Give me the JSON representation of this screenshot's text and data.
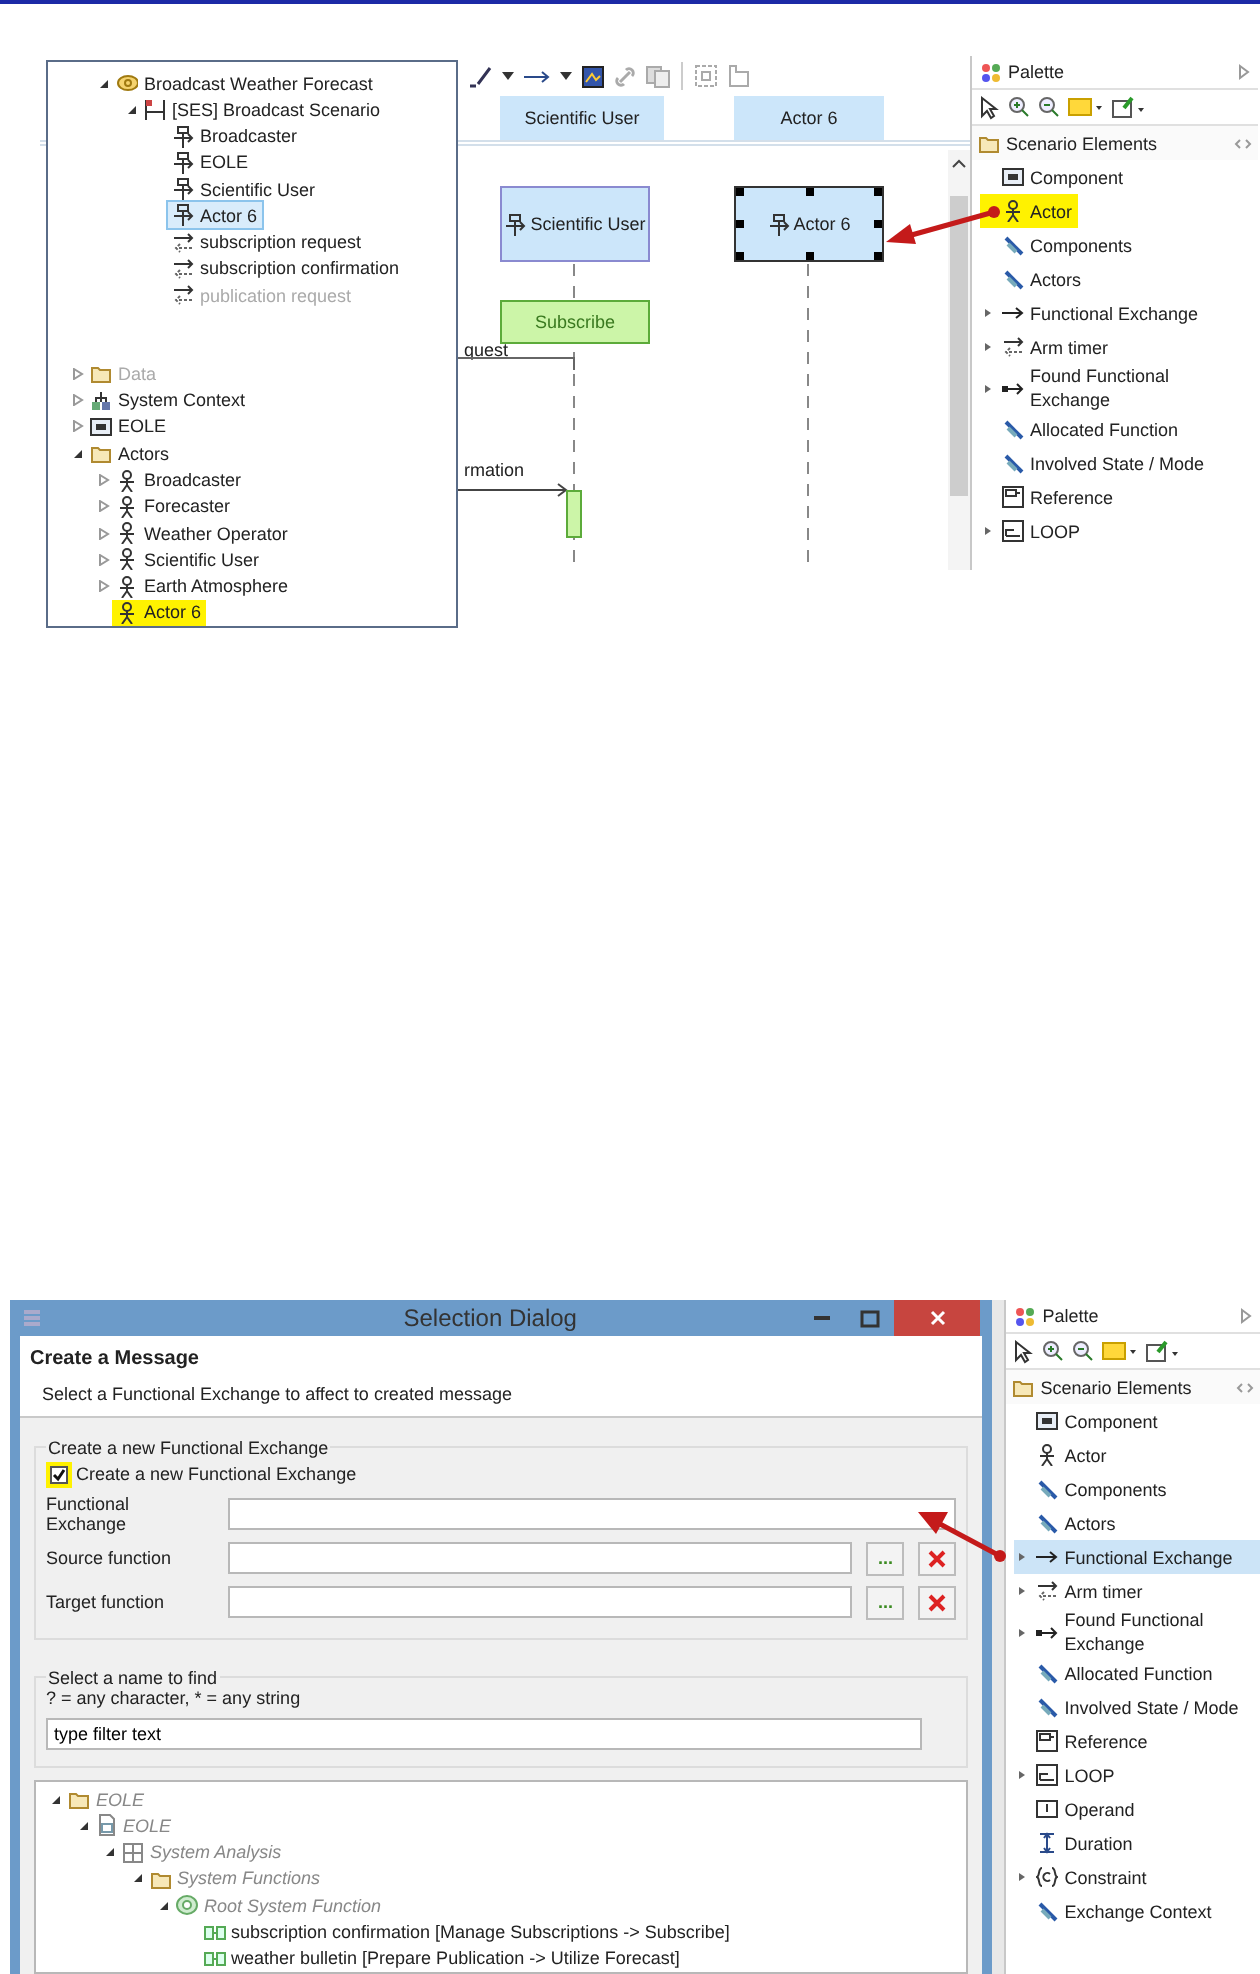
{
  "editor": {
    "lifeline_headers": [
      "Scientific User",
      "Actor 6"
    ],
    "lifelines": [
      {
        "label": "Scientific User",
        "selected": false
      },
      {
        "label": "Actor 6",
        "selected": true
      }
    ],
    "execution": "Subscribe",
    "messages": [
      "quest",
      "rmation"
    ]
  },
  "model_tree": {
    "upper": [
      {
        "label": "Broadcast Weather Forecast",
        "kind": "capability",
        "expanded": true,
        "selected": false,
        "highlighted": false,
        "faded": false,
        "children": [
          {
            "label": "[SES] Broadcast Scenario",
            "kind": "scenario",
            "expanded": true,
            "selected": false,
            "highlighted": false,
            "faded": false,
            "children": [
              {
                "label": "Broadcaster",
                "kind": "lifeline",
                "selected": false,
                "highlighted": false,
                "faded": false
              },
              {
                "label": "EOLE",
                "kind": "lifeline",
                "selected": false,
                "highlighted": false,
                "faded": false
              },
              {
                "label": "Scientific User",
                "kind": "lifeline",
                "selected": false,
                "highlighted": false,
                "faded": false
              },
              {
                "label": "Actor 6",
                "kind": "lifeline",
                "selected": true,
                "highlighted": false,
                "faded": false
              },
              {
                "label": "subscription request",
                "kind": "exchange",
                "selected": false,
                "highlighted": false,
                "faded": false
              },
              {
                "label": "subscription confirmation",
                "kind": "exchange",
                "selected": false,
                "highlighted": false,
                "faded": false
              },
              {
                "label": "publication request",
                "kind": "exchange",
                "selected": false,
                "highlighted": false,
                "faded": true
              }
            ]
          }
        ]
      }
    ],
    "lower": [
      {
        "label": "Data",
        "kind": "folder",
        "expanded": false,
        "selected": false,
        "highlighted": false,
        "faded": true
      },
      {
        "label": "System Context",
        "kind": "context",
        "expanded": false,
        "selected": false,
        "highlighted": false,
        "faded": false
      },
      {
        "label": "EOLE",
        "kind": "component",
        "expanded": false,
        "selected": false,
        "highlighted": false,
        "faded": false
      },
      {
        "label": "Actors",
        "kind": "folder",
        "expanded": true,
        "selected": false,
        "highlighted": false,
        "faded": false,
        "children": [
          {
            "label": "Broadcaster",
            "kind": "actor",
            "expanded": false,
            "selected": false,
            "highlighted": false,
            "faded": false
          },
          {
            "label": "Forecaster",
            "kind": "actor",
            "expanded": false,
            "selected": false,
            "highlighted": false,
            "faded": false
          },
          {
            "label": "Weather Operator",
            "kind": "actor",
            "expanded": false,
            "selected": false,
            "highlighted": false,
            "faded": false
          },
          {
            "label": "Scientific User",
            "kind": "actor",
            "expanded": false,
            "selected": false,
            "highlighted": false,
            "faded": false
          },
          {
            "label": "Earth Atmosphere",
            "kind": "actor",
            "expanded": false,
            "selected": false,
            "highlighted": false,
            "faded": false
          },
          {
            "label": "Actor 6",
            "kind": "actor",
            "selected": false,
            "highlighted": true,
            "faded": false
          }
        ]
      }
    ]
  },
  "palette_top": {
    "title": "Palette",
    "drawer": "Scenario Elements",
    "items": [
      {
        "label": "Component",
        "kind": "component",
        "selected": false,
        "highlighted": false
      },
      {
        "label": "Actor",
        "kind": "actor",
        "selected": false,
        "highlighted": true
      },
      {
        "label": "Components",
        "kind": "filter",
        "selected": false,
        "highlighted": false
      },
      {
        "label": "Actors",
        "kind": "filter",
        "selected": false,
        "highlighted": false
      },
      {
        "label": "Functional Exchange",
        "kind": "arrow",
        "expanded": false,
        "selected": false,
        "highlighted": false
      },
      {
        "label": "Arm timer",
        "kind": "exchange",
        "expanded": false,
        "selected": false,
        "highlighted": false
      },
      {
        "label": "Found Functional Exchange",
        "kind": "found",
        "expanded": false,
        "selected": false,
        "highlighted": false
      },
      {
        "label": "Allocated Function",
        "kind": "filter",
        "selected": false,
        "highlighted": false
      },
      {
        "label": "Involved State / Mode",
        "kind": "filter",
        "selected": false,
        "highlighted": false
      },
      {
        "label": "Reference",
        "kind": "reference",
        "selected": false,
        "highlighted": false
      },
      {
        "label": "LOOP",
        "kind": "loop",
        "expanded": false,
        "selected": false,
        "highlighted": false
      }
    ]
  },
  "dialog": {
    "title": "Selection Dialog",
    "heading": "Create a Message",
    "description": "Select a Functional Exchange to affect to created message",
    "exchange_group": {
      "legend": "Create a new Functional Exchange",
      "checkbox": {
        "label": "Create a new Functional Exchange",
        "checked": true,
        "highlighted": true
      },
      "fields": [
        {
          "label": "Functional Exchange",
          "kind": "plain"
        },
        {
          "label": "Source function",
          "kind": "browse",
          "browse_label": "..."
        },
        {
          "label": "Target function",
          "kind": "browse",
          "browse_label": "..."
        }
      ]
    },
    "filter_group": {
      "legend": "Select a name to find",
      "hint": "? = any character, * = any string",
      "value": "type filter text"
    },
    "tree": [
      {
        "label": "EOLE",
        "kind": "folder",
        "expanded": true,
        "disabled": true,
        "selected": false,
        "children": [
          {
            "label": "EOLE",
            "kind": "project",
            "expanded": true,
            "disabled": true,
            "selected": false,
            "children": [
              {
                "label": "System Analysis",
                "kind": "grid",
                "expanded": true,
                "disabled": true,
                "selected": false,
                "children": [
                  {
                    "label": "System Functions",
                    "kind": "folder",
                    "expanded": true,
                    "disabled": true,
                    "selected": false,
                    "children": [
                      {
                        "label": "Root System Function",
                        "kind": "function",
                        "expanded": true,
                        "disabled": true,
                        "selected": false,
                        "children": [
                          {
                            "label": "subscription confirmation [Manage Subscriptions -> Subscribe]",
                            "kind": "link",
                            "disabled": false,
                            "selected": false
                          },
                          {
                            "label": "weather bulletin [Prepare Publication -> Utilize Forecast]",
                            "kind": "link",
                            "disabled": false,
                            "selected": false
                          }
                        ]
                      }
                    ]
                  }
                ]
              }
            ]
          }
        ]
      }
    ]
  },
  "palette_bottom": {
    "title": "Palette",
    "drawer": "Scenario Elements",
    "items": [
      {
        "label": "Component",
        "kind": "component",
        "selected": false,
        "highlighted": false
      },
      {
        "label": "Actor",
        "kind": "actor",
        "selected": false,
        "highlighted": false
      },
      {
        "label": "Components",
        "kind": "filter",
        "selected": false,
        "highlighted": false
      },
      {
        "label": "Actors",
        "kind": "filter",
        "selected": false,
        "highlighted": false
      },
      {
        "label": "Functional Exchange",
        "kind": "arrow",
        "expanded": false,
        "selected": true,
        "highlighted": false
      },
      {
        "label": "Arm timer",
        "kind": "exchange",
        "expanded": false,
        "selected": false,
        "highlighted": false
      },
      {
        "label": "Found Functional Exchange",
        "kind": "found",
        "expanded": false,
        "selected": false,
        "highlighted": false
      },
      {
        "label": "Allocated Function",
        "kind": "filter",
        "selected": false,
        "highlighted": false
      },
      {
        "label": "Involved State / Mode",
        "kind": "filter",
        "selected": false,
        "highlighted": false
      },
      {
        "label": "Reference",
        "kind": "reference",
        "selected": false,
        "highlighted": false
      },
      {
        "label": "LOOP",
        "kind": "loop",
        "expanded": false,
        "selected": false,
        "highlighted": false
      },
      {
        "label": "Operand",
        "kind": "operand",
        "selected": false,
        "highlighted": false
      },
      {
        "label": "Duration",
        "kind": "duration",
        "selected": false,
        "highlighted": false
      },
      {
        "label": "Constraint",
        "kind": "constraint",
        "expanded": false,
        "selected": false,
        "highlighted": false
      },
      {
        "label": "Exchange Context",
        "kind": "filter",
        "selected": false,
        "highlighted": false
      }
    ]
  }
}
